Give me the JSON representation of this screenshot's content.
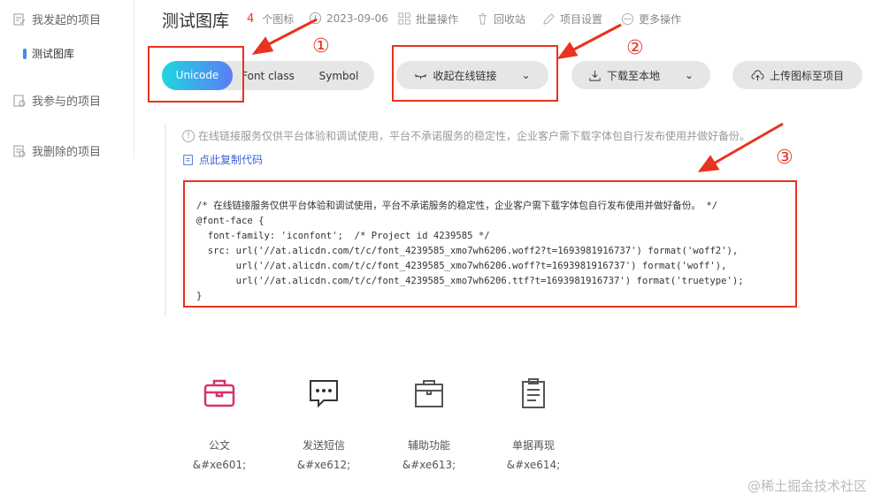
{
  "sidebar": {
    "items": [
      {
        "label": "我发起的项目"
      },
      {
        "label": "测试图库"
      },
      {
        "label": "我参与的项目"
      },
      {
        "label": "我删除的项目"
      }
    ]
  },
  "header": {
    "title": "测试图库",
    "count": "4",
    "count_label": "个图标",
    "date": "2023-09-06",
    "actions": [
      "批量操作",
      "回收站",
      "项目设置",
      "更多操作"
    ]
  },
  "tabs": [
    "Unicode",
    "Font class",
    "Symbol"
  ],
  "buttons": {
    "collapse": "收起在线链接",
    "download": "下载至本地",
    "upload": "上传图标至项目"
  },
  "notice": "在线链接服务仅供平台体验和调试使用，平台不承诺服务的稳定性，企业客户需下载字体包自行发布使用并做好备份。",
  "copy_label": "点此复制代码",
  "code": [
    "/* 在线链接服务仅供平台体验和调试使用，平台不承诺服务的稳定性，企业客户需下载字体包自行发布使用并做好备份。 */",
    "@font-face {",
    "  font-family: 'iconfont';  /* Project id 4239585 */",
    "  src: url('//at.alicdn.com/t/c/font_4239585_xmo7wh6206.woff2?t=1693981916737') format('woff2'),",
    "       url('//at.alicdn.com/t/c/font_4239585_xmo7wh6206.woff?t=1693981916737') format('woff'),",
    "       url('//at.alicdn.com/t/c/font_4239585_xmo7wh6206.ttf?t=1693981916737') format('truetype');",
    "}"
  ],
  "icons": [
    {
      "name": "公文",
      "code": "&#xe601;"
    },
    {
      "name": "发送短信",
      "code": "&#xe612;"
    },
    {
      "name": "辅助功能",
      "code": "&#xe613;"
    },
    {
      "name": "单据再现",
      "code": "&#xe614;"
    }
  ],
  "annotations": [
    "①",
    "②",
    "③"
  ],
  "watermark": "@稀土掘金技术社区",
  "colors": {
    "accent": "#3a5fd6",
    "annotation": "#e8331e",
    "briefcase": "#d6336c"
  }
}
